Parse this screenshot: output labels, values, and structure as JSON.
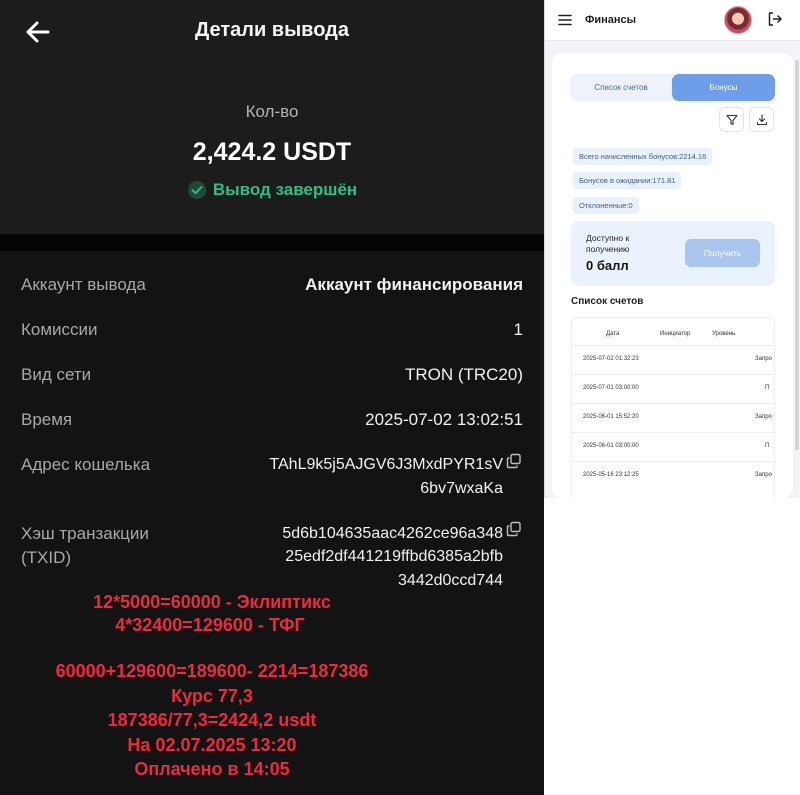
{
  "withdrawal": {
    "title": "Детали вывода",
    "amount_label": "Кол-во",
    "amount_value": "2,424.2 USDT",
    "status": "Вывод завершён",
    "rows": [
      {
        "label": "Аккаунт вывода",
        "value": "Аккаунт финансирования"
      },
      {
        "label": "Комиссии",
        "value": "1"
      },
      {
        "label": "Вид сети",
        "value": "TRON (TRC20)"
      },
      {
        "label": "Время",
        "value": "2025-07-02 13:02:51"
      }
    ],
    "address_label": "Адрес кошелька",
    "address_lines": [
      "TAhL9k5j5AJGV6J3MxdPYR1sV",
      "6bv7wxaKa"
    ],
    "txid_label_lines": [
      "Хэш транзакции",
      "(TXID)"
    ],
    "txid_lines": [
      "5d6b104635aac4262ce96a348",
      "25edf2df441219ffbd6385a2bfb",
      "3442d0ccd744"
    ]
  },
  "notes": [
    "12*5000=60000 - Эклиптикс",
    "4*32400=129600 - ТФГ",
    "60000+129600=189600- 2214=187386",
    "Курс 77,3",
    "187386/77,3=2424,2 usdt",
    "На 02.07.2025 13:20",
    "Оплачено в 14:05"
  ],
  "finance": {
    "title": "Финансы",
    "tabs": [
      "Список счетов",
      "Бонусы"
    ],
    "active_tab": "Бонусы",
    "total_bonus": "Всего начисленных бонусов:2214.16",
    "pending_bonus": "Бонусов в ожидании:171.81",
    "rejected": "Отклоненные:0",
    "available_label": "Доступно к получению",
    "available_value": "0 балл",
    "receive_button": "Получить",
    "list_title": "Список счетов",
    "table_headers": [
      "Дата",
      "Инициатор",
      "Уровень"
    ],
    "table_rows": [
      {
        "date": "2025-07-02 01:32:23",
        "status": "Запро"
      },
      {
        "date": "2025-07-01 03:00:00",
        "status": "П"
      },
      {
        "date": "2025-06-01 15:52:20",
        "status": "Запро"
      },
      {
        "date": "2025-06-01 03:00:00",
        "status": "П"
      },
      {
        "date": "2025-05-16 23:12:25",
        "status": "Запро"
      }
    ]
  },
  "colors": {
    "status_green": "#2ebd85",
    "note_red": "#f0283d",
    "accent_blue": "#6f9ee8"
  }
}
